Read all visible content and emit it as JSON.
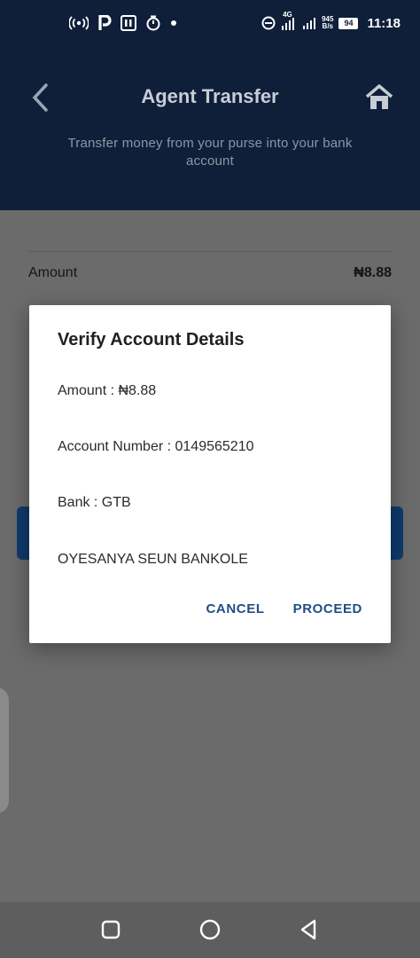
{
  "status_bar": {
    "left_icons": [
      "hotspot-icon",
      "parking-icon",
      "nfc-icon",
      "timer-icon",
      "dot-icon"
    ],
    "network_type": "4G",
    "speed_value": "945",
    "speed_unit": "B/s",
    "battery": "94",
    "time": "11:18"
  },
  "header": {
    "title": "Agent Transfer",
    "subtitle": "Transfer money from your purse into your bank account",
    "back_icon": "chevron-left-icon",
    "home_icon": "home-icon"
  },
  "form": {
    "amount_label": "Amount",
    "amount_value": "₦8.88"
  },
  "dialog": {
    "title": "Verify Account Details",
    "amount_line": "Amount : ₦8.88",
    "account_line": "Account Number : 0149565210",
    "bank_line": "Bank : GTB",
    "name_line": "OYESANYA SEUN BANKOLE",
    "cancel_label": "CANCEL",
    "proceed_label": "PROCEED"
  },
  "nav_bar": {
    "buttons": [
      "recents-icon",
      "home-circle-icon",
      "back-triangle-icon"
    ]
  },
  "colors": {
    "header_bg": "#0f1f3a",
    "accent": "#1f4e86",
    "scrim": "#6b6b6b"
  }
}
